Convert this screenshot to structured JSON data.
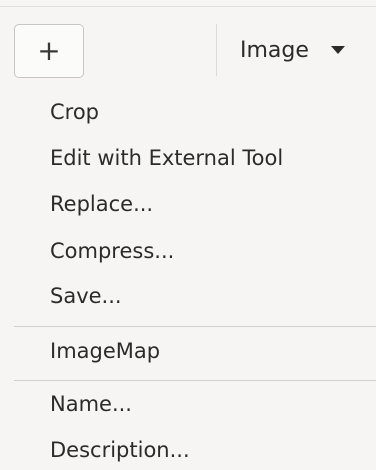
{
  "toolbar": {
    "add_label": "+",
    "image_menu_label": "Image"
  },
  "menu": {
    "group1": [
      "Crop",
      "Edit with External Tool",
      "Replace...",
      "Compress...",
      "Save..."
    ],
    "group2": [
      "ImageMap"
    ],
    "group3": [
      "Name...",
      "Description..."
    ]
  }
}
